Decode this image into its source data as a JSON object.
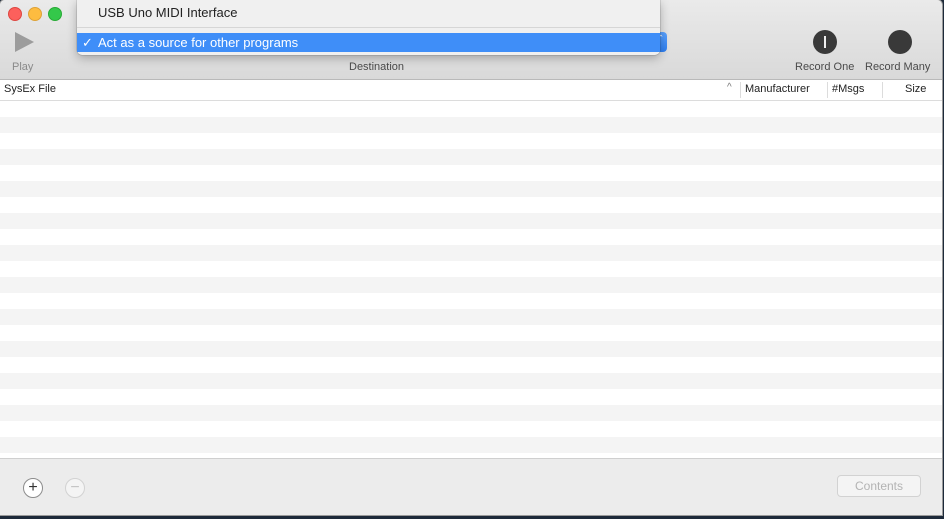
{
  "toolbar": {
    "play_label": "Play",
    "destination_label": "Destination",
    "record_one_label": "Record One",
    "record_many_label": "Record Many"
  },
  "destination_menu": {
    "items": [
      {
        "label": "USB Uno MIDI Interface",
        "selected": false
      },
      {
        "label": "Act as a source for other programs",
        "selected": true,
        "check": "✓"
      }
    ],
    "accent_color": "#3f8ef8"
  },
  "table": {
    "columns": [
      {
        "label": "SysEx File",
        "sort_indicator": "^"
      },
      {
        "label": "Manufacturer"
      },
      {
        "label": "#Msgs"
      },
      {
        "label": "Size"
      }
    ],
    "rows": []
  },
  "bottom_bar": {
    "add_symbol": "+",
    "remove_symbol": "−",
    "contents_label": "Contents"
  },
  "icons": {
    "play": "play-icon",
    "record_one": "record-one-icon",
    "record_many": "record-many-icon"
  }
}
